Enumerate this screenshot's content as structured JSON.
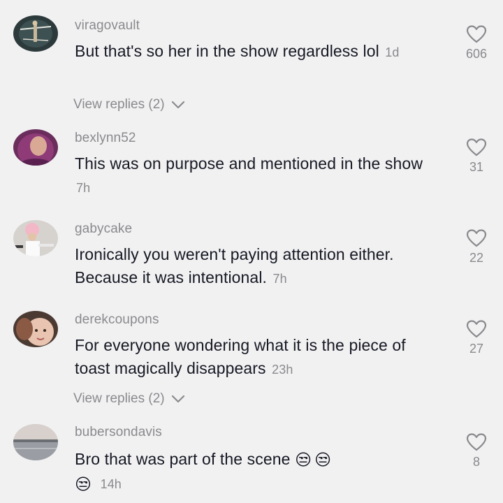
{
  "comments": [
    {
      "username": "viragovault",
      "text": "But that's so her in the show regardless lol",
      "timestamp": "1d",
      "likes": "606",
      "view_replies": "View replies (2)",
      "avatar_icon": "avatar-dark-circle-figure"
    },
    {
      "username": "bexlynn52",
      "text": "This was on purpose and mentioned in the show",
      "timestamp": "7h",
      "likes": "31",
      "avatar_icon": "avatar-purple-hair-person"
    },
    {
      "username": "gabycake",
      "text": "Ironically you weren't paying attention either. Because it was intentional.",
      "timestamp": "7h",
      "likes": "22",
      "avatar_icon": "avatar-pink-hat-person"
    },
    {
      "username": "derekcoupons",
      "text": "For everyone wondering what it is the piece of toast magically disappears",
      "timestamp": "23h",
      "likes": "27",
      "view_replies": "View replies (2)",
      "avatar_icon": "avatar-child-face"
    },
    {
      "username": "bubersondavis",
      "text": "Bro that was part of the scene",
      "emojis": [
        "😒",
        "😒",
        "😒"
      ],
      "timestamp": "14h",
      "likes": "8",
      "avatar_icon": "avatar-lake-sunset"
    }
  ],
  "colors": {
    "background": "#f1f1f2",
    "text": "#161823",
    "secondary": "#8a8a8e"
  }
}
